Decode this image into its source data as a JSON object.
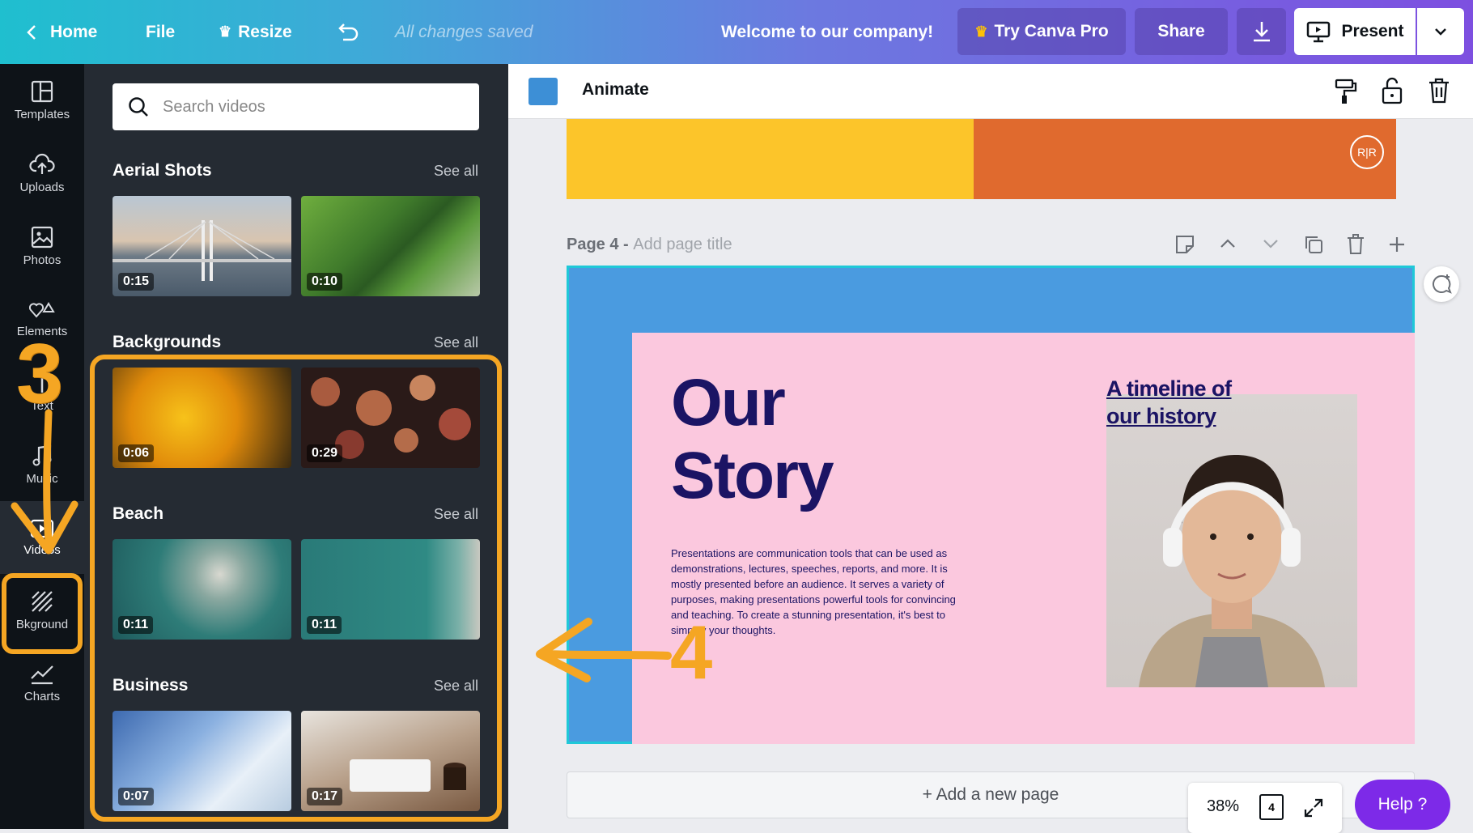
{
  "topbar": {
    "home": "Home",
    "file": "File",
    "resize": "Resize",
    "saved_status": "All changes saved",
    "doc_title": "Welcome to our company!",
    "try_pro": "Try Canva Pro",
    "share": "Share",
    "present": "Present"
  },
  "leftnav": {
    "items": [
      {
        "label": "Templates",
        "icon": "templates-icon"
      },
      {
        "label": "Uploads",
        "icon": "upload-cloud-icon"
      },
      {
        "label": "Photos",
        "icon": "image-icon"
      },
      {
        "label": "Elements",
        "icon": "shapes-icon"
      },
      {
        "label": "Text",
        "icon": "text-icon"
      },
      {
        "label": "Music",
        "icon": "music-icon"
      },
      {
        "label": "Videos",
        "icon": "video-icon"
      },
      {
        "label": "Bkground",
        "icon": "background-icon"
      },
      {
        "label": "Charts",
        "icon": "chart-line-icon"
      }
    ]
  },
  "panel": {
    "search_placeholder": "Search videos",
    "see_all": "See all",
    "sections": [
      {
        "title": "Aerial Shots",
        "videos": [
          {
            "duration": "0:15"
          },
          {
            "duration": "0:10"
          }
        ]
      },
      {
        "title": "Backgrounds",
        "videos": [
          {
            "duration": "0:06"
          },
          {
            "duration": "0:29"
          }
        ]
      },
      {
        "title": "Beach",
        "videos": [
          {
            "duration": "0:11"
          },
          {
            "duration": "0:11"
          }
        ]
      },
      {
        "title": "Business",
        "videos": [
          {
            "duration": "0:07"
          },
          {
            "duration": "0:17"
          }
        ]
      }
    ]
  },
  "editor": {
    "color_swatch": "#3d8fd6",
    "animate": "Animate",
    "prev_page_badge": "R|R",
    "page_label": "Page 4 -",
    "page_title_placeholder": "Add page title",
    "slide": {
      "heading_line1": "Our",
      "heading_line2": "Story",
      "subheading_line1": "A timeline of",
      "subheading_line2": "our history",
      "body": "Presentations are communication tools that can be used as demonstrations, lectures, speeches, reports, and more. It is mostly presented before an audience. It serves a variety of purposes, making presentations powerful tools for convincing and teaching. To create a stunning presentation, it's best to simplify your thoughts."
    },
    "add_page": "+ Add a new page",
    "zoom": "38%",
    "page_count": "4",
    "help": "Help ?"
  },
  "annotations": {
    "step3": "3",
    "step4": "4"
  },
  "colors": {
    "accent_orange": "#f5a623",
    "slide_blue": "#4a9be0",
    "slide_pink": "#fbc8de",
    "heading_navy": "#1b1464"
  }
}
